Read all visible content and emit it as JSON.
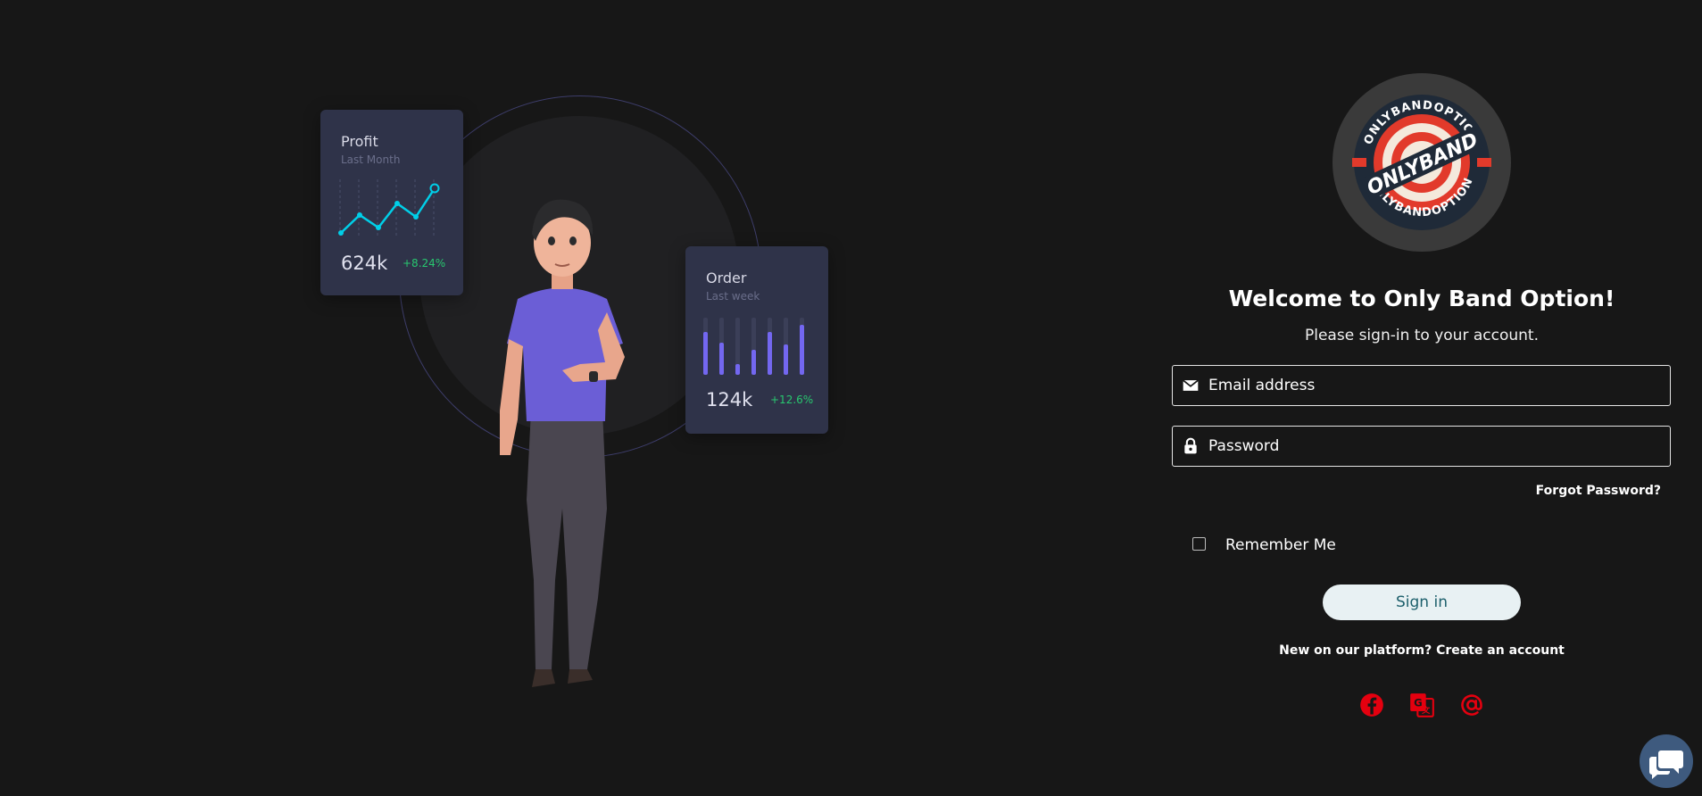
{
  "illustration": {
    "profit_card": {
      "title": "Profit",
      "subtitle": "Last Month",
      "value": "624k",
      "delta": "+8.24%",
      "line_color": "#00cfe8"
    },
    "order_card": {
      "title": "Order",
      "subtitle": "Last week",
      "value": "124k",
      "delta": "+12.6%",
      "bar_color": "#7367f0"
    }
  },
  "logo": {
    "ring_text_top": "ONLYBANDOPTION",
    "ring_text_bottom": "ONLYBANDOPTION",
    "center_text": "ONLYBAND"
  },
  "login": {
    "title": "Welcome to Only Band Option!",
    "subtitle": "Please sign-in to your account.",
    "email_placeholder": "Email address",
    "password_placeholder": "Password",
    "forgot_label": "Forgot Password?",
    "remember_label": "Remember Me",
    "signin_label": "Sign in",
    "create_account_label": "New on our platform? Create an account"
  },
  "social": [
    {
      "icon": "facebook-icon",
      "color": "#e4000f"
    },
    {
      "icon": "google-translate-icon",
      "color": "#e4000f"
    },
    {
      "icon": "at-sign-icon",
      "color": "#e4000f"
    }
  ],
  "chat_widget": {
    "icon": "chat-icon",
    "color": "#3e5a7e"
  }
}
